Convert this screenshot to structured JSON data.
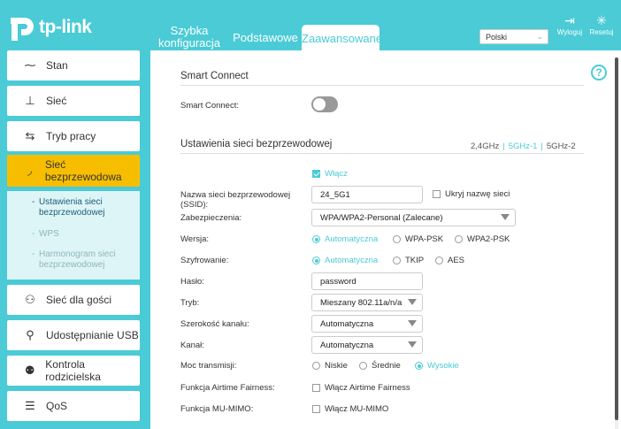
{
  "header": {
    "logo_text": "tp-link",
    "tabs": [
      {
        "label_line1": "Szybka",
        "label_line2": "konfiguracja"
      },
      {
        "label": "Podstawowe"
      },
      {
        "label": "Zaawansowane"
      }
    ],
    "language": "Polski",
    "logout_label": "Wyloguj",
    "reset_label": "Resetuj"
  },
  "sidebar": {
    "items": [
      {
        "label": "Stan",
        "icon": "pulse-icon"
      },
      {
        "label": "Sieć",
        "icon": "network-icon"
      },
      {
        "label": "Tryb pracy",
        "icon": "switch-mode-icon"
      },
      {
        "label": "Sieć bezprzewodowa",
        "icon": "wifi-icon"
      },
      {
        "label": "Sieć dla gości",
        "icon": "guest-icon"
      },
      {
        "label": "Udostępnianie USB",
        "icon": "usb-icon"
      },
      {
        "label": "Kontrola rodzicielska",
        "icon": "parental-icon"
      },
      {
        "label": "QoS",
        "icon": "qos-icon"
      }
    ],
    "submenu": [
      {
        "line1": "Ustawienia sieci",
        "line2": "bezprzewodowej"
      },
      {
        "line1": "WPS",
        "line2": ""
      },
      {
        "line1": "Harmonogram sieci",
        "line2": "bezprzewodowej"
      }
    ]
  },
  "smart_connect": {
    "title": "Smart Connect",
    "label": "Smart Connect:",
    "enabled": false
  },
  "wireless": {
    "title": "Ustawienia sieci bezprzewodowej",
    "bands": [
      "2,4GHz",
      "5GHz-1",
      "5GHz-2"
    ],
    "enable_label": "Włącz",
    "ssid_label_line1": "Nazwa sieci bezprzewodowej",
    "ssid_label_line2": "(SSID):",
    "ssid_value": "24_5G1",
    "hide_ssid_label": "Ukryj nazwę sieci",
    "security_label": "Zabezpieczenia:",
    "security_value": "WPA/WPA2-Personal (Zalecane)",
    "version_label": "Wersja:",
    "version_options": [
      "Automatyczna",
      "WPA-PSK",
      "WPA2-PSK"
    ],
    "encryption_label": "Szyfrowanie:",
    "encryption_options": [
      "Automatyczna",
      "TKIP",
      "AES"
    ],
    "password_label": "Hasło:",
    "password_value": "password",
    "mode_label": "Tryb:",
    "mode_value": "Mieszany 802.11a/n/a",
    "width_label": "Szerokość kanału:",
    "width_value": "Automatyczna",
    "channel_label": "Kanał:",
    "channel_value": "Automatyczna",
    "power_label": "Moc transmisji:",
    "power_options": [
      "Niskie",
      "Średnie",
      "Wysokie"
    ],
    "airtime_label": "Funkcja Airtime Fairness:",
    "airtime_option": "Włącz Airtime Fairness",
    "mumimo_label": "Funkcja MU-MIMO:",
    "mumimo_option": "Włącz MU-MIMO"
  },
  "colors": {
    "accent": "#4acbd6",
    "active_menu": "#f7be00"
  }
}
